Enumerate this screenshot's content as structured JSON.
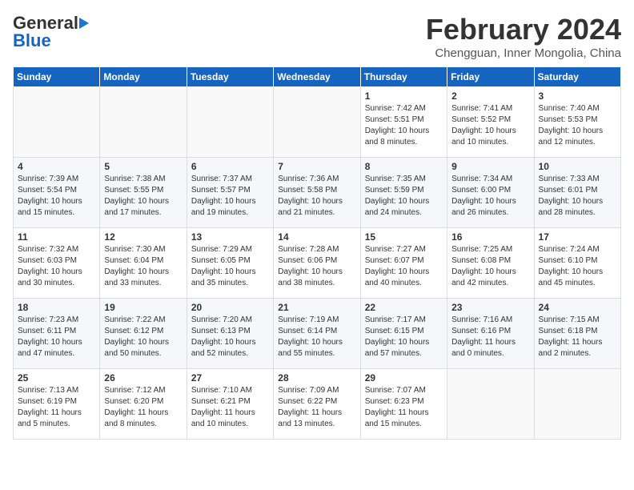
{
  "header": {
    "logo_general": "General",
    "logo_blue": "Blue",
    "month_title": "February 2024",
    "location": "Chengguan, Inner Mongolia, China"
  },
  "days_of_week": [
    "Sunday",
    "Monday",
    "Tuesday",
    "Wednesday",
    "Thursday",
    "Friday",
    "Saturday"
  ],
  "weeks": [
    [
      {
        "day": "",
        "info": ""
      },
      {
        "day": "",
        "info": ""
      },
      {
        "day": "",
        "info": ""
      },
      {
        "day": "",
        "info": ""
      },
      {
        "day": "1",
        "info": "Sunrise: 7:42 AM\nSunset: 5:51 PM\nDaylight: 10 hours\nand 8 minutes."
      },
      {
        "day": "2",
        "info": "Sunrise: 7:41 AM\nSunset: 5:52 PM\nDaylight: 10 hours\nand 10 minutes."
      },
      {
        "day": "3",
        "info": "Sunrise: 7:40 AM\nSunset: 5:53 PM\nDaylight: 10 hours\nand 12 minutes."
      }
    ],
    [
      {
        "day": "4",
        "info": "Sunrise: 7:39 AM\nSunset: 5:54 PM\nDaylight: 10 hours\nand 15 minutes."
      },
      {
        "day": "5",
        "info": "Sunrise: 7:38 AM\nSunset: 5:55 PM\nDaylight: 10 hours\nand 17 minutes."
      },
      {
        "day": "6",
        "info": "Sunrise: 7:37 AM\nSunset: 5:57 PM\nDaylight: 10 hours\nand 19 minutes."
      },
      {
        "day": "7",
        "info": "Sunrise: 7:36 AM\nSunset: 5:58 PM\nDaylight: 10 hours\nand 21 minutes."
      },
      {
        "day": "8",
        "info": "Sunrise: 7:35 AM\nSunset: 5:59 PM\nDaylight: 10 hours\nand 24 minutes."
      },
      {
        "day": "9",
        "info": "Sunrise: 7:34 AM\nSunset: 6:00 PM\nDaylight: 10 hours\nand 26 minutes."
      },
      {
        "day": "10",
        "info": "Sunrise: 7:33 AM\nSunset: 6:01 PM\nDaylight: 10 hours\nand 28 minutes."
      }
    ],
    [
      {
        "day": "11",
        "info": "Sunrise: 7:32 AM\nSunset: 6:03 PM\nDaylight: 10 hours\nand 30 minutes."
      },
      {
        "day": "12",
        "info": "Sunrise: 7:30 AM\nSunset: 6:04 PM\nDaylight: 10 hours\nand 33 minutes."
      },
      {
        "day": "13",
        "info": "Sunrise: 7:29 AM\nSunset: 6:05 PM\nDaylight: 10 hours\nand 35 minutes."
      },
      {
        "day": "14",
        "info": "Sunrise: 7:28 AM\nSunset: 6:06 PM\nDaylight: 10 hours\nand 38 minutes."
      },
      {
        "day": "15",
        "info": "Sunrise: 7:27 AM\nSunset: 6:07 PM\nDaylight: 10 hours\nand 40 minutes."
      },
      {
        "day": "16",
        "info": "Sunrise: 7:25 AM\nSunset: 6:08 PM\nDaylight: 10 hours\nand 42 minutes."
      },
      {
        "day": "17",
        "info": "Sunrise: 7:24 AM\nSunset: 6:10 PM\nDaylight: 10 hours\nand 45 minutes."
      }
    ],
    [
      {
        "day": "18",
        "info": "Sunrise: 7:23 AM\nSunset: 6:11 PM\nDaylight: 10 hours\nand 47 minutes."
      },
      {
        "day": "19",
        "info": "Sunrise: 7:22 AM\nSunset: 6:12 PM\nDaylight: 10 hours\nand 50 minutes."
      },
      {
        "day": "20",
        "info": "Sunrise: 7:20 AM\nSunset: 6:13 PM\nDaylight: 10 hours\nand 52 minutes."
      },
      {
        "day": "21",
        "info": "Sunrise: 7:19 AM\nSunset: 6:14 PM\nDaylight: 10 hours\nand 55 minutes."
      },
      {
        "day": "22",
        "info": "Sunrise: 7:17 AM\nSunset: 6:15 PM\nDaylight: 10 hours\nand 57 minutes."
      },
      {
        "day": "23",
        "info": "Sunrise: 7:16 AM\nSunset: 6:16 PM\nDaylight: 11 hours\nand 0 minutes."
      },
      {
        "day": "24",
        "info": "Sunrise: 7:15 AM\nSunset: 6:18 PM\nDaylight: 11 hours\nand 2 minutes."
      }
    ],
    [
      {
        "day": "25",
        "info": "Sunrise: 7:13 AM\nSunset: 6:19 PM\nDaylight: 11 hours\nand 5 minutes."
      },
      {
        "day": "26",
        "info": "Sunrise: 7:12 AM\nSunset: 6:20 PM\nDaylight: 11 hours\nand 8 minutes."
      },
      {
        "day": "27",
        "info": "Sunrise: 7:10 AM\nSunset: 6:21 PM\nDaylight: 11 hours\nand 10 minutes."
      },
      {
        "day": "28",
        "info": "Sunrise: 7:09 AM\nSunset: 6:22 PM\nDaylight: 11 hours\nand 13 minutes."
      },
      {
        "day": "29",
        "info": "Sunrise: 7:07 AM\nSunset: 6:23 PM\nDaylight: 11 hours\nand 15 minutes."
      },
      {
        "day": "",
        "info": ""
      },
      {
        "day": "",
        "info": ""
      }
    ]
  ]
}
